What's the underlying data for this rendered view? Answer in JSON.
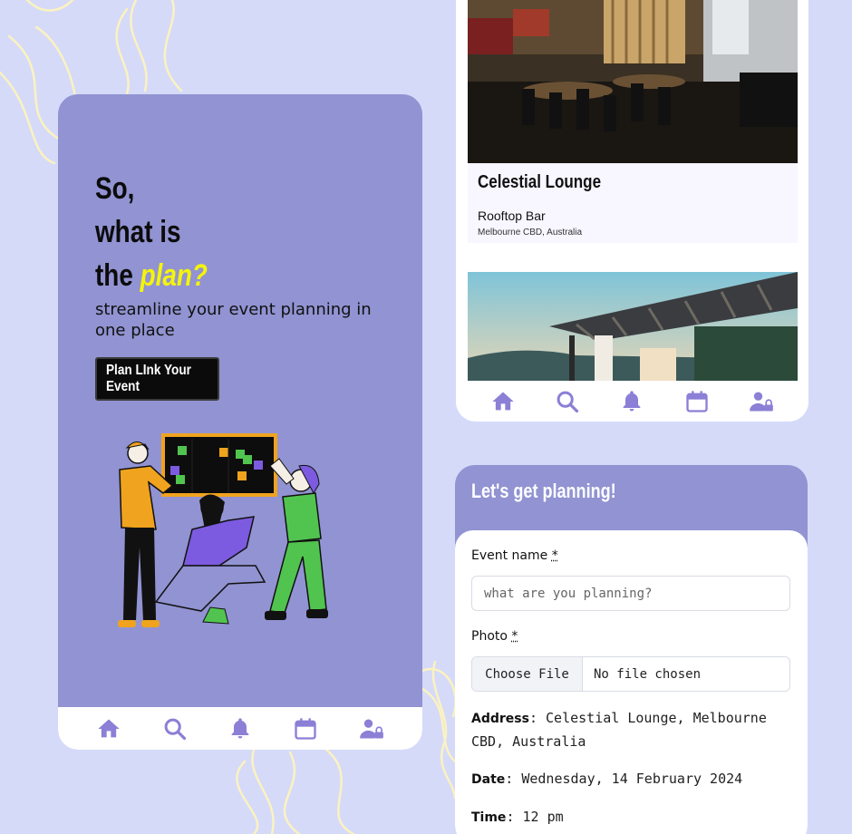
{
  "colors": {
    "background": "#d5daf9",
    "panel": "#9193d2",
    "accent_yellow": "#f4f40a",
    "nav_icon": "#8b7fd6",
    "squiggle": "#fbf2c0"
  },
  "home": {
    "title_line1": "So,",
    "title_line2": "what is",
    "title_line3_prefix": "the",
    "title_line3_accent": "plan?",
    "subtitle": "streamline your event planning in one place",
    "cta_label": "Plan LInk Your Event"
  },
  "nav": {
    "items": [
      {
        "name": "home",
        "icon": "home-icon"
      },
      {
        "name": "search",
        "icon": "search-icon"
      },
      {
        "name": "notifications",
        "icon": "bell-icon"
      },
      {
        "name": "calendar",
        "icon": "calendar-icon"
      },
      {
        "name": "profile",
        "icon": "user-lock-icon"
      }
    ]
  },
  "venues": [
    {
      "name": "Celestial Lounge",
      "type": "Rooftop Bar",
      "location": "Melbourne CBD, Australia"
    }
  ],
  "form": {
    "title": "Let's get planning!",
    "event_name_label": "Event name",
    "event_name_placeholder": "what are you planning?",
    "photo_label": "Photo",
    "required_marker": "*",
    "file_button": "Choose File",
    "file_status": "No file chosen",
    "address_label": "Address",
    "address_value": "Celestial Lounge, Melbourne CBD, Australia",
    "date_label": "Date",
    "date_value": "Wednesday, 14 February 2024",
    "time_label": "Time",
    "time_value": "12 pm"
  }
}
